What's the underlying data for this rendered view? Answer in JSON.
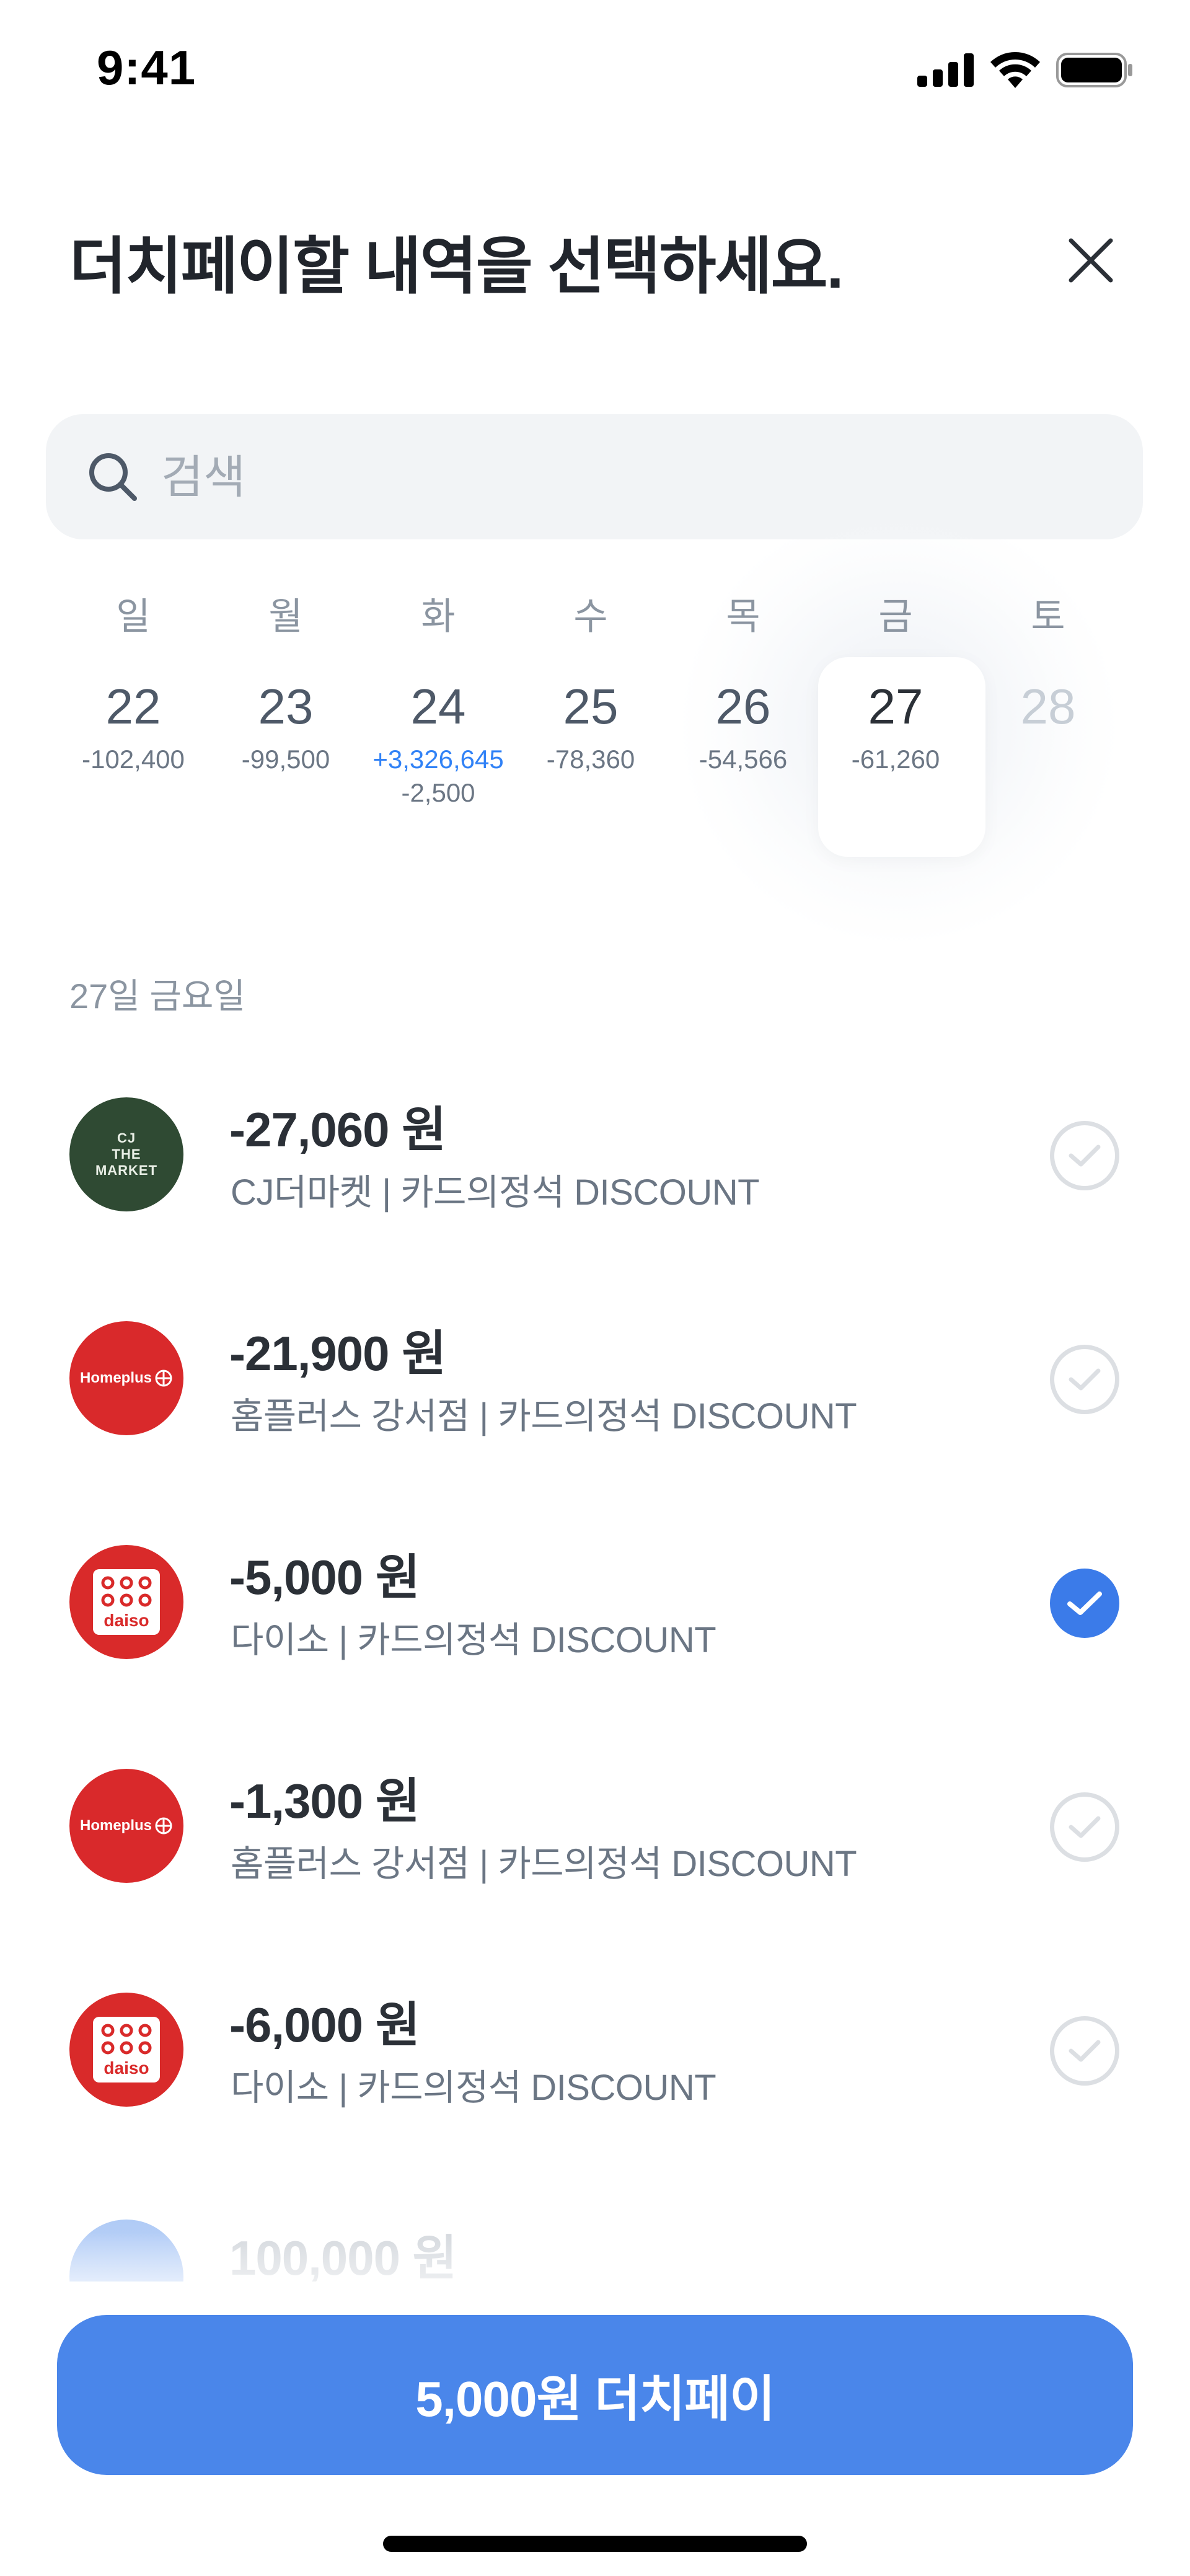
{
  "status_bar": {
    "time": "9:41"
  },
  "header": {
    "title": "더치페이할 내역을 선택하세요."
  },
  "search": {
    "placeholder": "검색"
  },
  "week": {
    "days": [
      {
        "dow": "일",
        "num": "22",
        "amounts": [
          "-102,400"
        ]
      },
      {
        "dow": "월",
        "num": "23",
        "amounts": [
          "-99,500"
        ]
      },
      {
        "dow": "화",
        "num": "24",
        "amounts": [
          "+3,326,645",
          "-2,500"
        ]
      },
      {
        "dow": "수",
        "num": "25",
        "amounts": [
          "-78,360"
        ]
      },
      {
        "dow": "목",
        "num": "26",
        "amounts": [
          "-54,566"
        ]
      },
      {
        "dow": "금",
        "num": "27",
        "amounts": [
          "-61,260"
        ],
        "selected": true
      },
      {
        "dow": "토",
        "num": "28",
        "amounts": [],
        "muted": true
      }
    ]
  },
  "date_label": "27일 금요일",
  "transactions": [
    {
      "amount": "-27,060 원",
      "desc": "CJ더마켓 | 카드의정석 DISCOUNT",
      "logo": "cj-the-market",
      "logo_text": [
        "CJ",
        "THE",
        "MARKET"
      ],
      "checked": false
    },
    {
      "amount": "-21,900 원",
      "desc": "홈플러스 강서점 | 카드의정석 DISCOUNT",
      "logo": "homeplus",
      "logo_text": [
        "Homeplus"
      ],
      "checked": false
    },
    {
      "amount": "-5,000 원",
      "desc": "다이소 | 카드의정석 DISCOUNT",
      "logo": "daiso",
      "logo_text": [
        "daiso"
      ],
      "checked": true
    },
    {
      "amount": "-1,300 원",
      "desc": "홈플러스 강서점 | 카드의정석 DISCOUNT",
      "logo": "homeplus",
      "logo_text": [
        "Homeplus"
      ],
      "checked": false
    },
    {
      "amount": "-6,000 원",
      "desc": "다이소 | 카드의정석 DISCOUNT",
      "logo": "daiso",
      "logo_text": [
        "daiso"
      ],
      "checked": false
    }
  ],
  "partial_transaction": {
    "amount": "100,000 원"
  },
  "cta": {
    "label": "5,000원 더치페이"
  },
  "colors": {
    "accent": "#4a86ea",
    "check_on": "#3b7be9",
    "plus_amount": "#3182f6"
  }
}
